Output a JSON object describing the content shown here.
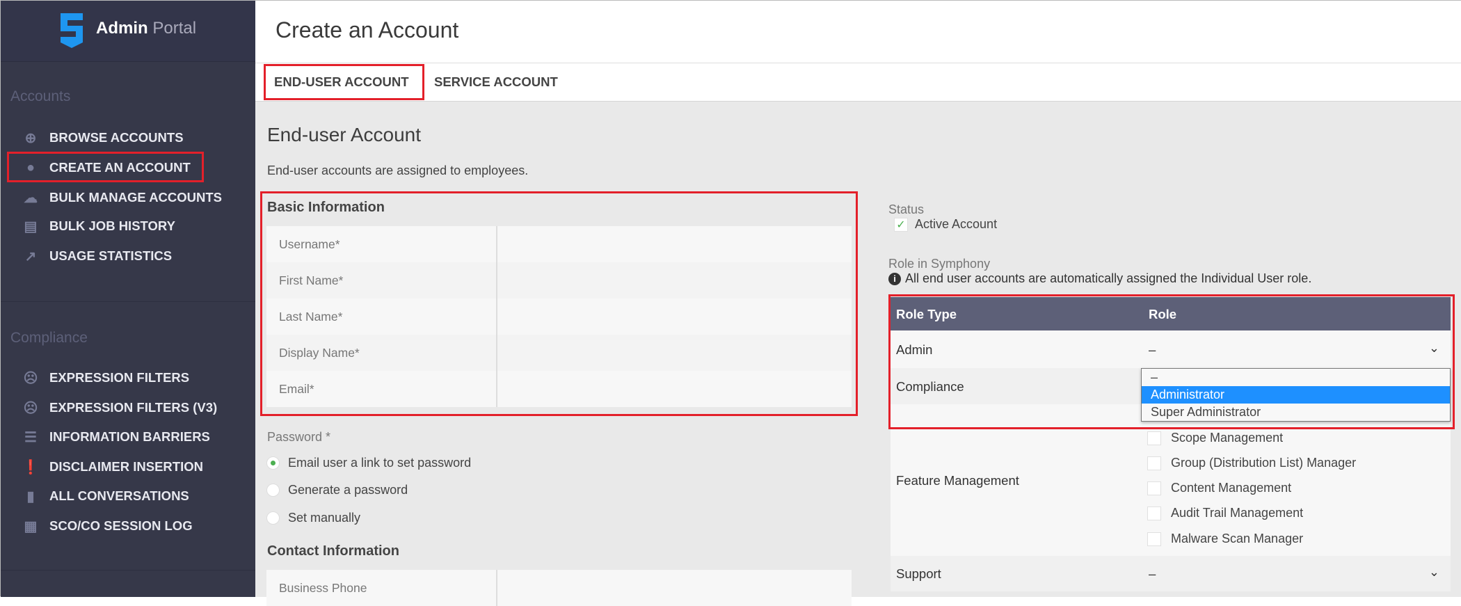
{
  "app": {
    "brand_bold": "Admin",
    "brand_light": "Portal"
  },
  "sidebar": {
    "sections": [
      {
        "title": "Accounts",
        "items": [
          {
            "label": "BROWSE ACCOUNTS",
            "icon": "search-user-icon"
          },
          {
            "label": "CREATE AN ACCOUNT",
            "icon": "user-icon",
            "highlighted": true
          },
          {
            "label": "BULK MANAGE ACCOUNTS",
            "icon": "cloud-icon"
          },
          {
            "label": "BULK JOB HISTORY",
            "icon": "inbox-icon"
          },
          {
            "label": "USAGE STATISTICS",
            "icon": "trend-chart-icon"
          }
        ]
      },
      {
        "title": "Compliance",
        "items": [
          {
            "label": "EXPRESSION FILTERS",
            "icon": "filter-face-icon"
          },
          {
            "label": "EXPRESSION FILTERS (V3)",
            "icon": "filter-face-icon"
          },
          {
            "label": "INFORMATION BARRIERS",
            "icon": "barrier-icon"
          },
          {
            "label": "DISCLAIMER INSERTION",
            "icon": "exclamation-icon"
          },
          {
            "label": "ALL CONVERSATIONS",
            "icon": "door-icon"
          },
          {
            "label": "SCO/CO SESSION LOG",
            "icon": "calendar-icon"
          }
        ]
      }
    ]
  },
  "page": {
    "title": "Create an Account",
    "tabs": [
      {
        "label": "END-USER ACCOUNT",
        "active": true
      },
      {
        "label": "SERVICE ACCOUNT"
      }
    ],
    "heading": "End-user Account",
    "description": "End-user accounts are assigned to employees.",
    "basic_info": {
      "title": "Basic Information",
      "fields": [
        {
          "label": "Username*",
          "value": ""
        },
        {
          "label": "First Name*",
          "value": ""
        },
        {
          "label": "Last Name*",
          "value": ""
        },
        {
          "label": "Display Name*",
          "value": ""
        },
        {
          "label": "Email*",
          "value": ""
        }
      ]
    },
    "password": {
      "label": "Password *",
      "options": [
        "Email user a link to set password",
        "Generate a password",
        "Set manually"
      ],
      "selected": 0
    },
    "contact_info": {
      "title": "Contact Information",
      "fields": [
        {
          "label": "Business Phone",
          "value": ""
        }
      ]
    },
    "status": {
      "label": "Status",
      "active_label": "Active Account",
      "active": true
    },
    "role": {
      "label": "Role in Symphony",
      "info": "All end user accounts are automatically assigned the Individual User role.",
      "headers": [
        "Role Type",
        "Role"
      ],
      "admin": {
        "label": "Admin",
        "value": "–"
      },
      "compliance": {
        "label": "Compliance"
      },
      "dropdown_options": [
        "–",
        "Administrator",
        "Super Administrator"
      ],
      "dropdown_highlighted": 1,
      "feature": {
        "label": "Feature Management",
        "options": [
          "Scope Management",
          "Group (Distribution List) Manager",
          "Content Management",
          "Audit Trail Management",
          "Malware Scan Manager"
        ]
      },
      "support": {
        "label": "Support",
        "value": "–"
      }
    }
  },
  "colors": {
    "sidebar": "#363849",
    "highlight": "#1e90ff",
    "annotation": "#e3202a",
    "table_header": "#5d6078"
  }
}
